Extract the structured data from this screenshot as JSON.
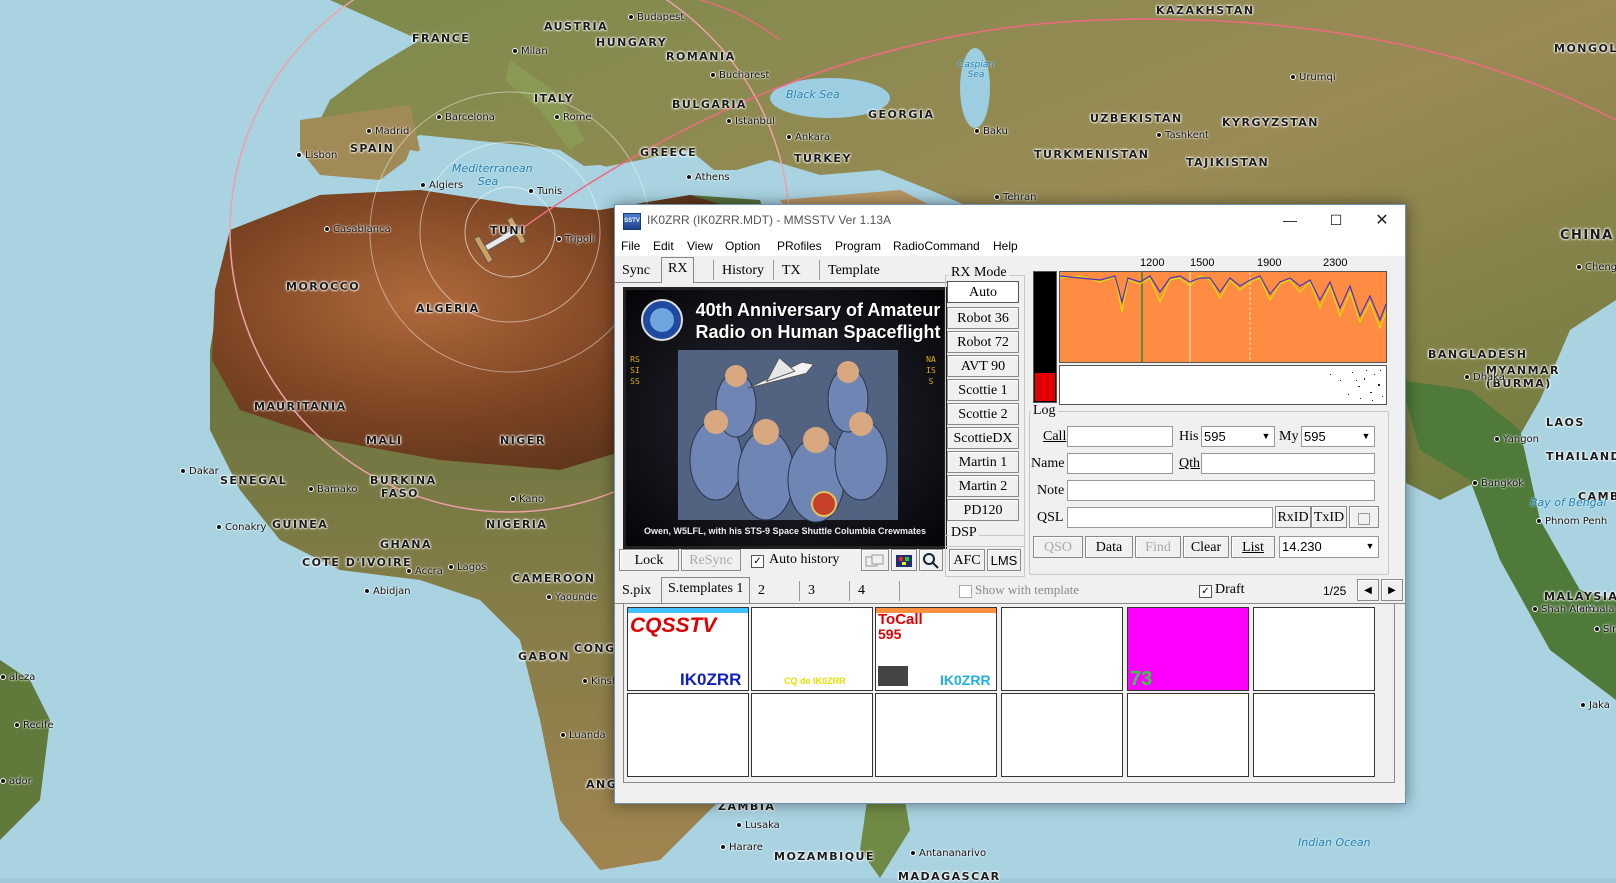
{
  "map": {
    "countries": [
      "FRANCE",
      "AUSTRIA",
      "HUNGARY",
      "ROMANIA",
      "ITALY",
      "BULGARIA",
      "SPAIN",
      "GREECE",
      "TURKEY",
      "GEORGIA",
      "KAZAKHSTAN",
      "UZBEKISTAN",
      "KYRGYZSTAN",
      "TURKMENISTAN",
      "TAJIKISTAN",
      "MONGOL",
      "CHINA",
      "MOROCCO",
      "ALGERIA",
      "MAURITANIA",
      "MALI",
      "NIGER",
      "SENEGAL",
      "BURKINA FASO",
      "GUINEA",
      "GHANA",
      "NIGERIA",
      "COTE D'IVOIRE",
      "CAMEROON",
      "GABON",
      "CONG",
      "ZAMBIA",
      "MOZAMBIQUE",
      "MADAGASCAR",
      "BANGLADESH",
      "MYANMAR (BURMA)",
      "LAOS",
      "THAILAND",
      "CAMBO",
      "MALAYSIA",
      "TUNI",
      "ANG"
    ],
    "cities": [
      "Budapest",
      "Milan",
      "Bucharest",
      "Rome",
      "Barcelona",
      "Madrid",
      "Lisbon",
      "Istanbul",
      "Ankara",
      "Athens",
      "Tunis",
      "Algiers",
      "Casablanca",
      "Tripoli",
      "Baku",
      "Tehran",
      "Tashkent",
      "Urumqi",
      "Chengd",
      "Dhaka",
      "Yangon",
      "Bangkok",
      "Phnom Penh",
      "Kuala L",
      "Shah Alam",
      "Jaka",
      "Dakar",
      "Bamako",
      "Conakry",
      "Accra",
      "Lagos",
      "Kano",
      "Abidjan",
      "Yaounde",
      "Kinsh",
      "Luanda",
      "Lusaka",
      "Harare",
      "Antananarivo",
      "Recife",
      "Sin"
    ],
    "seas": [
      "Mediterranean Sea",
      "Black Sea",
      "Caspian Sea",
      "Bay of Bengal",
      "Indian Ocean"
    ],
    "edge_text": [
      "aleza",
      "ador"
    ]
  },
  "window": {
    "title": "IK0ZRR (IK0ZRR.MDT) - MMSSTV Ver 1.13A",
    "icon_text": "SSTV",
    "controls": {
      "minimize": "—",
      "maximize": "☐",
      "close": "✕"
    }
  },
  "menu": [
    "File",
    "Edit",
    "View",
    "Option",
    "PRofiles",
    "Program",
    "RadioCommand",
    "Help"
  ],
  "tabs": [
    "Sync",
    "RX",
    "History",
    "TX",
    "Template"
  ],
  "rx_image": {
    "title_line1": "40th Anniversary of Amateur",
    "title_line2": "Radio on Human Spaceflight",
    "caption": "Owen, W5LFL, with his STS-9 Space Shuttle Columbia Crewmates",
    "left_vertical": "RSSISS",
    "right_vertical": "NAISS"
  },
  "rx_controls": {
    "lock": "Lock",
    "resync": "ReSync",
    "auto_history": "Auto history",
    "auto_history_checked": true
  },
  "rx_mode": {
    "title": "RX Mode",
    "modes": [
      "Auto",
      "Robot 36",
      "Robot 72",
      "AVT 90",
      "Scottie 1",
      "Scottie 2",
      "ScottieDX",
      "Martin 1",
      "Martin 2",
      "PD120"
    ],
    "selected": "Auto"
  },
  "dsp": {
    "title": "DSP",
    "afc": "AFC",
    "lms": "LMS"
  },
  "spectrum": {
    "ticks": [
      "1200",
      "1500",
      "1900",
      "2300"
    ],
    "level_fraction": 0.22
  },
  "log": {
    "title": "Log",
    "call_label": "Call",
    "his_label": "His",
    "his_value": "595",
    "my_label": "My",
    "my_value": "595",
    "name_label": "Name",
    "qth_label": "Qth",
    "note_label": "Note",
    "qsl_label": "QSL",
    "rxid": "RxID",
    "txid": "TxID",
    "buttons": [
      "QSO",
      "Data",
      "Find",
      "Clear",
      "List"
    ],
    "frequency": "14.230"
  },
  "templates": {
    "tabs": [
      "S.pix",
      "S.templates 1",
      "2",
      "3",
      "4"
    ],
    "show_with_template": "Show with template",
    "draft": "Draft",
    "draft_checked": true,
    "page": "1/25",
    "thumb_texts": {
      "t1_big": "CQSSTV",
      "t1_call": "IK0ZRR",
      "t2_text": "CQ de IK0ZRR",
      "t3_big": "ToCall",
      "t3_rst": "595",
      "t3_call": "IK0ZRR",
      "t5_big": "73"
    }
  }
}
